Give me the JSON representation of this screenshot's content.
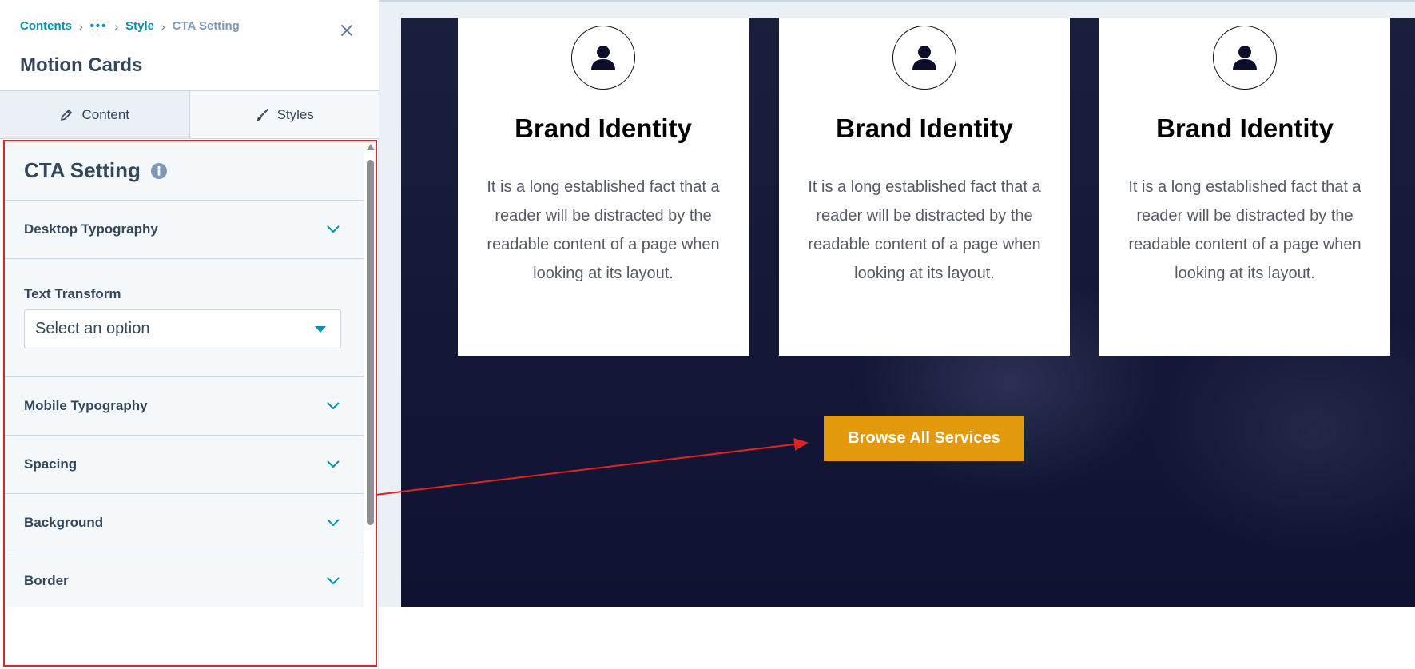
{
  "panel": {
    "breadcrumb": {
      "contents": "Contents",
      "ellipsis": "•••",
      "style": "Style",
      "current": "CTA Setting"
    },
    "title": "Motion Cards",
    "tabs": [
      {
        "label": "Content",
        "icon": "pencil-icon"
      },
      {
        "label": "Styles",
        "icon": "brush-icon"
      }
    ],
    "section": {
      "title": "CTA Setting",
      "accordions": [
        {
          "label": "Desktop Typography"
        },
        {
          "label": "Mobile Typography"
        },
        {
          "label": "Spacing"
        },
        {
          "label": "Background"
        },
        {
          "label": "Border"
        }
      ],
      "text_transform": {
        "label": "Text Transform",
        "placeholder": "Select an option"
      }
    }
  },
  "preview": {
    "cards": [
      {
        "title": "Brand Identity",
        "body": "It is a long established fact that a reader will be distracted by the readable content of a page when looking at its layout."
      },
      {
        "title": "Brand Identity",
        "body": "It is a long established fact that a reader will be distracted by the readable content of a page when looking at its layout."
      },
      {
        "title": "Brand Identity",
        "body": "It is a long established fact that a reader will be distracted by the readable content of a page when looking at its layout."
      }
    ],
    "cta_label": "Browse All Services"
  },
  "colors": {
    "accent": "#0091ae",
    "cta": "#e29a0c",
    "highlight": "#e02424",
    "hero_dark": "#141836"
  }
}
